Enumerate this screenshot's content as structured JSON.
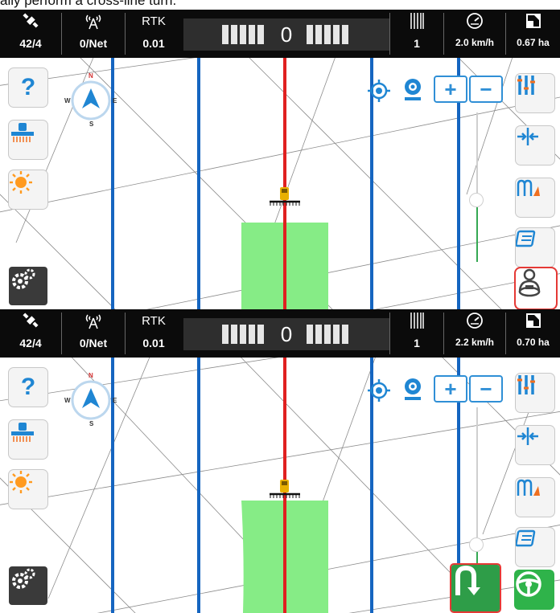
{
  "caption": "ally perform a cross-line turn.",
  "screens": [
    {
      "topbar": {
        "satellites": "42/4",
        "network": "0/Net",
        "rtk_label": "RTK",
        "rtk_value": "0.01",
        "lightbar_value": "0",
        "swath": "1",
        "speed": "2.0 km/h",
        "area": "0.67 ha"
      },
      "compass": {
        "n": "N",
        "s": "S",
        "w": "W",
        "e": "E"
      },
      "action_button": "autosteer-engage-button"
    },
    {
      "topbar": {
        "satellites": "42/4",
        "network": "0/Net",
        "rtk_label": "RTK",
        "rtk_value": "0.01",
        "lightbar_value": "0",
        "swath": "1",
        "speed": "2.2 km/h",
        "area": "0.70 ha"
      },
      "compass": {
        "n": "N",
        "s": "S",
        "w": "W",
        "e": "E"
      },
      "action_button": "u-turn-button"
    }
  ],
  "colors": {
    "guide_line": "#1565c0",
    "active_line": "#e02020",
    "coverage": "#86ec86",
    "highlight": "#e53935",
    "autosteer_active": "#2fb34a"
  }
}
